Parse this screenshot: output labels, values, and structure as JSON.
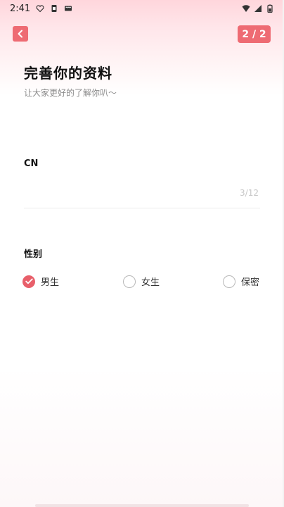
{
  "status_bar": {
    "time": "2:41",
    "left_icons": [
      "heart-icon",
      "sim-icon",
      "sms-icon"
    ],
    "right_icons": [
      "wifi-icon",
      "signal-icon",
      "battery-icon"
    ]
  },
  "header": {
    "back_icon": "chevron-left-icon",
    "step": "2 / 2"
  },
  "intro": {
    "title": "完善你的资料",
    "subtitle": "让大家更好的了解你叭～"
  },
  "cn_field": {
    "label": "CN",
    "value": "",
    "placeholder": "",
    "counter": "3/12"
  },
  "gender": {
    "label": "性别",
    "options": [
      {
        "label": "男生",
        "selected": true
      },
      {
        "label": "女生",
        "selected": false
      },
      {
        "label": "保密",
        "selected": false
      }
    ]
  },
  "colors": {
    "accent": "#ee6b73",
    "radio_selected": "#e85f6a",
    "muted_text": "#8c8c8c"
  }
}
